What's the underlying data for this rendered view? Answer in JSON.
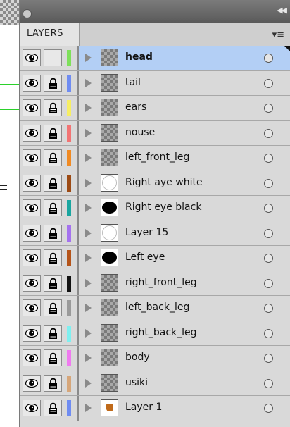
{
  "panel": {
    "tab_label": "LAYERS",
    "menu_icon": "panel-menu-icon",
    "collapse_icon": "collapse-double-arrow-icon"
  },
  "layers": [
    {
      "name": "head",
      "color": "#7ee05a",
      "thumb": "checker",
      "selected": true,
      "bold": true,
      "locked": false
    },
    {
      "name": "tail",
      "color": "#6f8cf2",
      "thumb": "checker",
      "selected": false,
      "bold": false,
      "locked": true
    },
    {
      "name": "ears",
      "color": "#f6ee63",
      "thumb": "checker",
      "selected": false,
      "bold": false,
      "locked": true
    },
    {
      "name": "nouse",
      "color": "#f27474",
      "thumb": "checker",
      "selected": false,
      "bold": false,
      "locked": true
    },
    {
      "name": "left_front_leg",
      "color": "#f08a23",
      "thumb": "checker",
      "selected": false,
      "bold": false,
      "locked": true
    },
    {
      "name": "Right aye white",
      "color": "#9c4a14",
      "thumb": "circle-white",
      "selected": false,
      "bold": false,
      "locked": true
    },
    {
      "name": "Right eye black",
      "color": "#1aa6a0",
      "thumb": "circle-black",
      "selected": false,
      "bold": false,
      "locked": true
    },
    {
      "name": "Layer 15",
      "color": "#a572ef",
      "thumb": "circle-white",
      "selected": false,
      "bold": false,
      "locked": true
    },
    {
      "name": "Left eye",
      "color": "#b5541a",
      "thumb": "circle-black",
      "selected": false,
      "bold": false,
      "locked": true
    },
    {
      "name": "right_front_leg",
      "color": "#111111",
      "thumb": "checker",
      "selected": false,
      "bold": false,
      "locked": true
    },
    {
      "name": "left_back_leg",
      "color": "#9a9a9a",
      "thumb": "checker",
      "selected": false,
      "bold": false,
      "locked": true
    },
    {
      "name": "right_back_leg",
      "color": "#7ff0f0",
      "thumb": "checker",
      "selected": false,
      "bold": false,
      "locked": true
    },
    {
      "name": "body",
      "color": "#f07af0",
      "thumb": "checker",
      "selected": false,
      "bold": false,
      "locked": true
    },
    {
      "name": "usiki",
      "color": "#d6a67a",
      "thumb": "checker",
      "selected": false,
      "bold": false,
      "locked": true
    },
    {
      "name": "Layer 1",
      "color": "#6f8cf2",
      "thumb": "figure",
      "selected": false,
      "bold": false,
      "locked": true
    }
  ]
}
